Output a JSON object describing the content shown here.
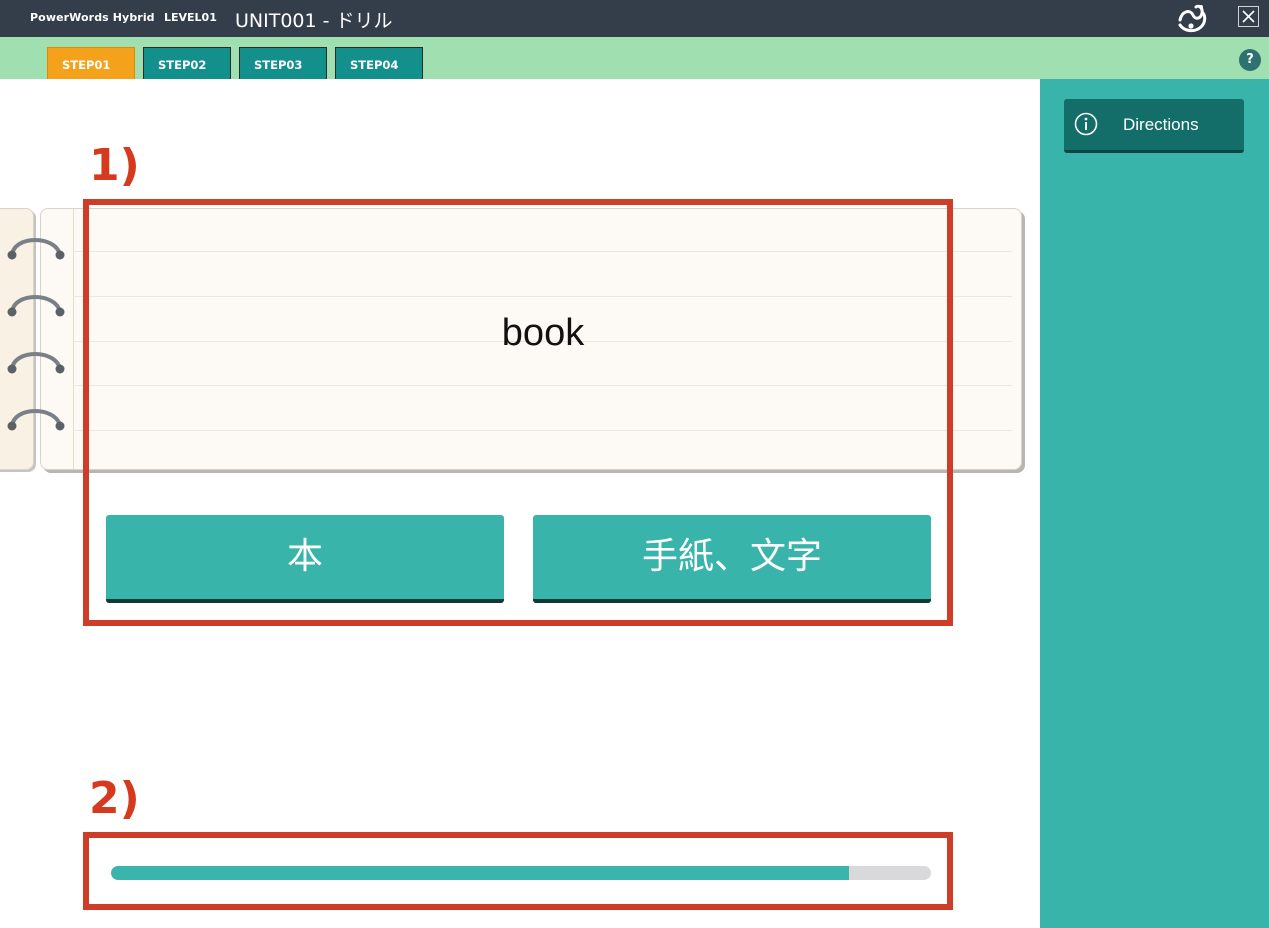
{
  "titlebar": {
    "app_name": "PowerWords Hybrid",
    "level": "LEVEL01",
    "unit_title": "UNIT001 - ドリル",
    "close_icon": "close-icon",
    "logo": "app-logo"
  },
  "tabs": [
    {
      "label": "STEP01",
      "active": true
    },
    {
      "label": "STEP02",
      "active": false
    },
    {
      "label": "STEP03",
      "active": false
    },
    {
      "label": "STEP04",
      "active": false
    }
  ],
  "help": {
    "label": "?"
  },
  "sidebar": {
    "directions_label": "Directions",
    "directions_icon": "info-icon"
  },
  "card": {
    "word": "book"
  },
  "answers": [
    {
      "label": "本"
    },
    {
      "label": "手紙、文字"
    }
  ],
  "annotations": [
    {
      "label": "1)"
    },
    {
      "label": "2)"
    }
  ],
  "progress": {
    "fraction": 0.9
  },
  "colors": {
    "titlebar_bg": "#343e4b",
    "tabstrip_bg": "#a0e0b0",
    "tab_active": "#f4a21c",
    "tab_inactive": "#13908c",
    "accent_teal": "#38b4ab",
    "annotation_red": "#cd3d27"
  }
}
